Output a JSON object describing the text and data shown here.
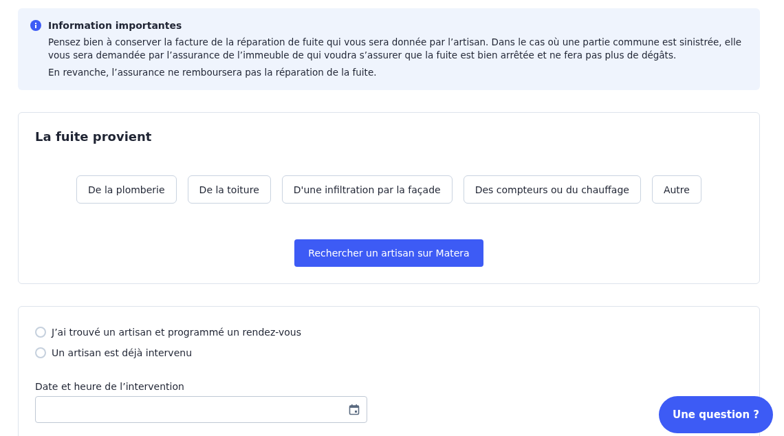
{
  "info": {
    "title": "Information importantes",
    "paragraphs": [
      "Pensez bien à conserver la facture de la réparation de fuite qui vous sera donnée par l’artisan. Dans le cas où une partie commune est sinistrée, elle vous sera demandée par l’assurance de l’immeuble de qui voudra s’assurer que la fuite est bien arrêtée et ne fera pas plus de dégâts.",
      "En revanche, l’assurance ne remboursera pas la réparation de la fuite."
    ]
  },
  "source": {
    "title": "La fuite provient",
    "options": [
      {
        "label": "De la plomberie",
        "selected": false
      },
      {
        "label": "De la toiture",
        "selected": false
      },
      {
        "label": "D'une infiltration par la façade",
        "selected": false
      },
      {
        "label": "Des compteurs ou du chauffage",
        "selected": false
      },
      {
        "label": "Autre",
        "selected": false
      }
    ],
    "action": "Rechercher un artisan sur Matera"
  },
  "intervention": {
    "choices": [
      {
        "label": "J’ai trouvé un artisan et programmé un rendez-vous",
        "selected": false
      },
      {
        "label": "Un artisan est déjà intervenu",
        "selected": false
      }
    ],
    "date_label": "Date et heure de l’intervention"
  },
  "help_button": "Une question ?"
}
